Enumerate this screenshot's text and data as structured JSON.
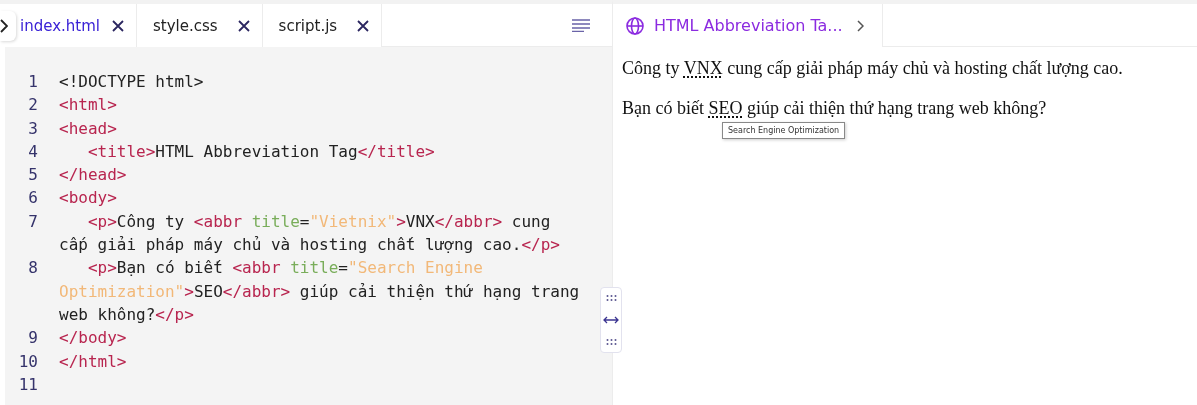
{
  "editor": {
    "tabs": [
      {
        "label": "index.html",
        "selected": true
      },
      {
        "label": "style.css",
        "selected": false
      },
      {
        "label": "script.js",
        "selected": false
      }
    ],
    "lines": [
      {
        "number": "1",
        "tokens": [
          {
            "kind": "text",
            "text": "<!DOCTYPE html>"
          }
        ]
      },
      {
        "number": "2",
        "tokens": [
          {
            "kind": "tag",
            "text": "<html>"
          }
        ]
      },
      {
        "number": "3",
        "tokens": [
          {
            "kind": "tag",
            "text": "<head>"
          }
        ]
      },
      {
        "number": "4",
        "indent": true,
        "tokens": [
          {
            "kind": "tag",
            "text": "<title>"
          },
          {
            "kind": "text",
            "text": "HTML Abbreviation Tag"
          },
          {
            "kind": "tag",
            "text": "</title>"
          }
        ]
      },
      {
        "number": "5",
        "tokens": [
          {
            "kind": "tag",
            "text": "</head>"
          }
        ]
      },
      {
        "number": "6",
        "tokens": [
          {
            "kind": "tag",
            "text": "<body>"
          }
        ]
      },
      {
        "number": "7",
        "indent": true,
        "tokens": [
          {
            "kind": "tag",
            "text": "<p>"
          },
          {
            "kind": "text",
            "text": "Công ty "
          },
          {
            "kind": "tag",
            "text": "<abbr "
          },
          {
            "kind": "attr",
            "text": "title"
          },
          {
            "kind": "text",
            "text": "="
          },
          {
            "kind": "string",
            "text": "\"Vietnix\""
          },
          {
            "kind": "tag",
            "text": ">"
          },
          {
            "kind": "text",
            "text": "VNX"
          },
          {
            "kind": "tag",
            "text": "</abbr>"
          },
          {
            "kind": "text",
            "text": " cung cấp giải pháp máy chủ và hosting chất lượng cao."
          },
          {
            "kind": "tag",
            "text": "</p>"
          }
        ]
      },
      {
        "number": "8",
        "indent": true,
        "tokens": [
          {
            "kind": "tag",
            "text": "<p>"
          },
          {
            "kind": "text",
            "text": "Bạn có biết "
          },
          {
            "kind": "tag",
            "text": "<abbr "
          },
          {
            "kind": "attr",
            "text": "title"
          },
          {
            "kind": "text",
            "text": "="
          },
          {
            "kind": "string",
            "text": "\"Search Engine Optimization\""
          },
          {
            "kind": "tag",
            "text": ">"
          },
          {
            "kind": "text",
            "text": "SEO"
          },
          {
            "kind": "tag",
            "text": "</abbr>"
          },
          {
            "kind": "text",
            "text": " giúp cải thiện thứ hạng trang web không?"
          },
          {
            "kind": "tag",
            "text": "</p>"
          }
        ]
      },
      {
        "number": "9",
        "tokens": [
          {
            "kind": "tag",
            "text": "</body>"
          }
        ]
      },
      {
        "number": "10",
        "tokens": [
          {
            "kind": "tag",
            "text": "</html>"
          }
        ]
      },
      {
        "number": "11"
      }
    ]
  },
  "preview": {
    "tab_title": "HTML Abbreviation Ta...",
    "paragraphs": [
      {
        "parts": [
          {
            "kind": "text",
            "text": "Công ty "
          },
          {
            "kind": "abbr",
            "text": "VNX"
          },
          {
            "kind": "text",
            "text": " cung cấp giải pháp máy chủ và hosting chất lượng cao."
          }
        ]
      },
      {
        "parts": [
          {
            "kind": "text",
            "text": "Bạn có biết "
          },
          {
            "kind": "abbr",
            "text": "SEO"
          },
          {
            "kind": "text",
            "text": " giúp cải thiện thứ hạng trang web không?"
          }
        ]
      }
    ],
    "tooltip": "Search Engine Optimization"
  }
}
